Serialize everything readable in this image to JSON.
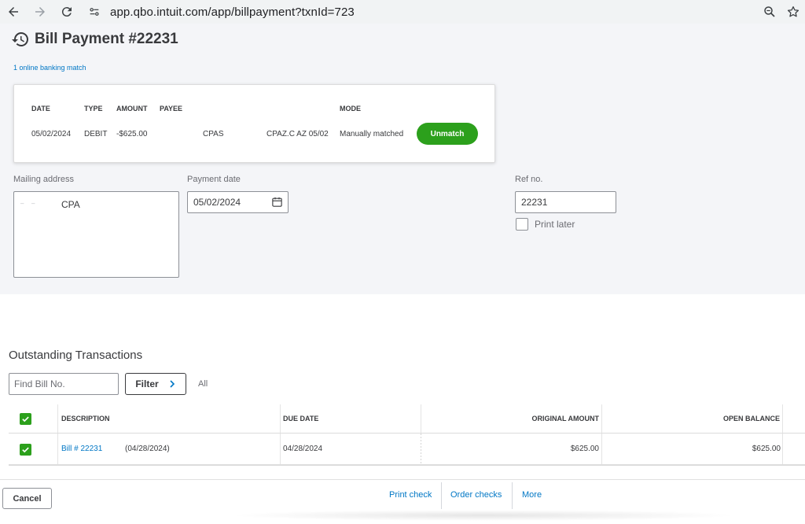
{
  "browser": {
    "url": "app.qbo.intuit.com/app/billpayment?txnId=723"
  },
  "page": {
    "title": "Bill Payment #22231",
    "match_link": "1 online banking match"
  },
  "match": {
    "headers": {
      "date": "DATE",
      "type": "TYPE",
      "amount": "AMOUNT",
      "payee": "PAYEE",
      "mode": "MODE"
    },
    "row": {
      "date": "05/02/2024",
      "type": "DEBIT",
      "amount": "-$625.00",
      "payee": "CPAS",
      "memo": "CPAZ.C AZ 05/02",
      "mode": "Manually matched"
    },
    "unmatch_label": "Unmatch"
  },
  "form": {
    "mailing_label": "Mailing address",
    "mailing_value": "CPA",
    "payment_date_label": "Payment date",
    "payment_date_value": "05/02/2024",
    "ref_label": "Ref no.",
    "ref_value": "22231",
    "print_later_label": "Print later"
  },
  "outstanding": {
    "title": "Outstanding Transactions",
    "find_placeholder": "Find Bill No.",
    "filter_label": "Filter",
    "all_label": "All",
    "columns": {
      "description": "DESCRIPTION",
      "due_date": "DUE DATE",
      "original_amount": "ORIGINAL AMOUNT",
      "open_balance": "OPEN BALANCE"
    },
    "rows": [
      {
        "bill": "Bill # 22231",
        "bill_date": "(04/28/2024)",
        "due_date": "04/28/2024",
        "original_amount": "$625.00",
        "open_balance": "$625.00"
      }
    ]
  },
  "footer": {
    "cancel_label": "Cancel",
    "print_check": "Print check",
    "order_checks": "Order checks",
    "more": "More"
  },
  "colors": {
    "accent_green": "#2ca01c",
    "link_blue": "#0077c5",
    "header_bg": "#f4f5f8"
  }
}
